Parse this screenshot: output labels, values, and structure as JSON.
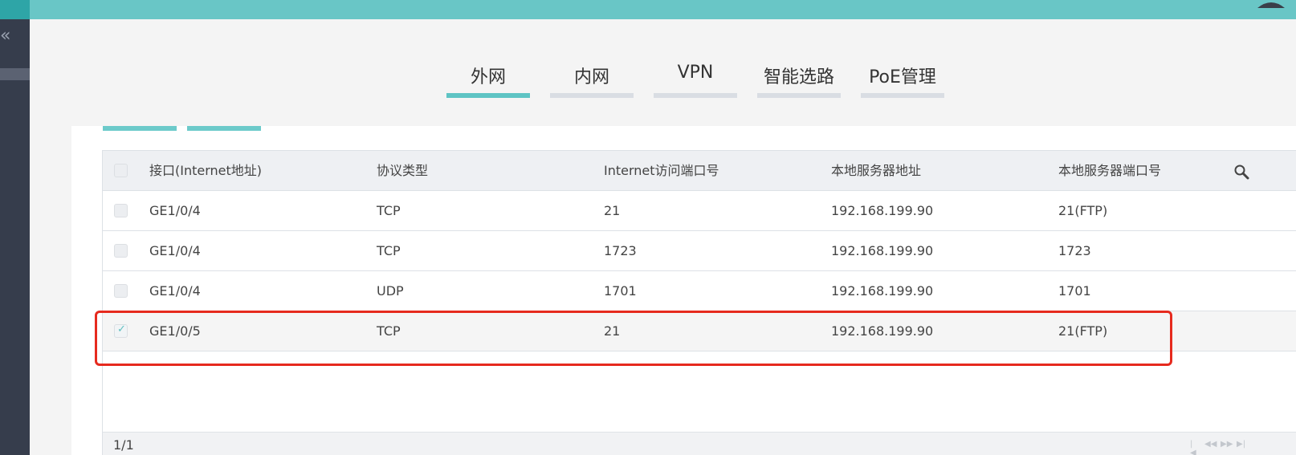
{
  "tabs": [
    {
      "label": "外网",
      "active": true
    },
    {
      "label": "内网",
      "active": false
    },
    {
      "label": "VPN",
      "active": false
    },
    {
      "label": "智能选路",
      "active": false
    },
    {
      "label": "PoE管理",
      "active": false
    }
  ],
  "sidebar": {
    "collapse_glyph": "«"
  },
  "table": {
    "columns": [
      "接口(Internet地址)",
      "协议类型",
      "Internet访问端口号",
      "本地服务器地址",
      "本地服务器端口号"
    ],
    "rows": [
      {
        "interface": "GE1/0/4",
        "protocol": "TCP",
        "internet_port": "21",
        "server_address": "192.168.199.90",
        "server_port": "21(FTP)",
        "checked": false
      },
      {
        "interface": "GE1/0/4",
        "protocol": "TCP",
        "internet_port": "1723",
        "server_address": "192.168.199.90",
        "server_port": "1723",
        "checked": false
      },
      {
        "interface": "GE1/0/4",
        "protocol": "UDP",
        "internet_port": "1701",
        "server_address": "192.168.199.90",
        "server_port": "1701",
        "checked": false
      },
      {
        "interface": "GE1/0/5",
        "protocol": "TCP",
        "internet_port": "21",
        "server_address": "192.168.199.90",
        "server_port": "21(FTP)",
        "checked": true
      }
    ],
    "selected_row": 3
  },
  "pagination": {
    "page_info": "1/1"
  },
  "icons": {
    "search": "search-icon",
    "user": "user-icon",
    "collapse": "double-chevron-left-icon"
  },
  "colors": {
    "topbar": "#69c6c6",
    "accent": "#5ec4c4",
    "sidebar": "#363d4c",
    "highlight": "#e62a1e"
  }
}
